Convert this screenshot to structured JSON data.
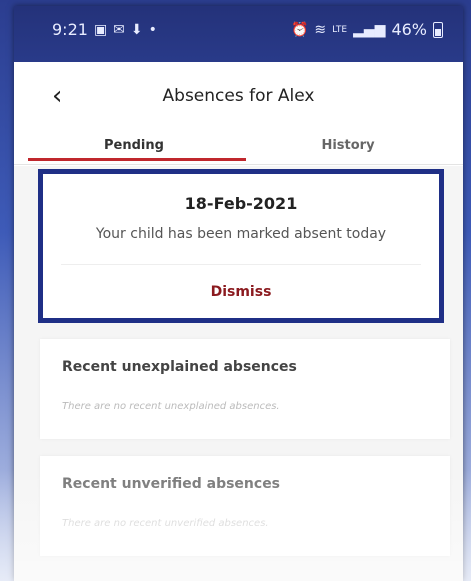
{
  "status_bar": {
    "time": "9:21",
    "left_icons": [
      "image-icon",
      "notification-icon",
      "download-icon",
      "dot-icon"
    ],
    "right_icons": [
      "alarm-icon",
      "wifi-icon",
      "volte-lte-icon",
      "signal-icon"
    ],
    "battery": "46%"
  },
  "header": {
    "title_prefix": "Absences for",
    "child_name": "Alex"
  },
  "tabs": [
    {
      "label": "Pending",
      "active": true
    },
    {
      "label": "History",
      "active": false
    }
  ],
  "absence_card": {
    "date": "18-Feb-2021",
    "message": "Your child has been marked absent today",
    "dismiss_label": "Dismiss"
  },
  "sections": [
    {
      "title": "Recent unexplained absences",
      "empty_text": "There are no recent unexplained absences."
    },
    {
      "title": "Recent unverified absences",
      "empty_text": "There are no recent unverified absences."
    }
  ],
  "colors": {
    "accent_red": "#c0272d",
    "dismiss_red": "#8b1a1f",
    "highlight_navy": "#1f2f86"
  }
}
